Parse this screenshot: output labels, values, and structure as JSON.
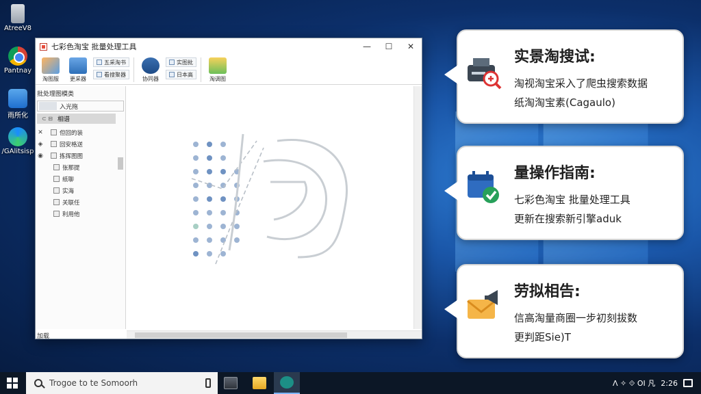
{
  "desktop": {
    "icons": [
      {
        "label": "AtreeV8",
        "icon": "recycle-bin-icon"
      },
      {
        "label": "Pantnay",
        "icon": "chrome-icon"
      },
      {
        "label": "雨所化",
        "icon": "document-icon"
      },
      {
        "label": "/GAlitsisp",
        "icon": "edge-icon"
      }
    ]
  },
  "window": {
    "title": "七彩色淘宝 批量处理工具",
    "controls": {
      "minimize": "—",
      "maximize": "☐",
      "close": "✕"
    },
    "ribbon": {
      "btn1": "淘图服",
      "btn2": "更采器",
      "small1": "五采淘书",
      "small2": "看搜聚器",
      "btn3": "协同器",
      "small3": "实图批",
      "small4": "日本高",
      "btn4": "淘调图"
    },
    "sidebar": {
      "header": "批处理图模类",
      "input_text": "入光拖",
      "selected": "相谱",
      "selected_arrow": "⊂  ⊟",
      "items": [
        {
          "label": "但回的装",
          "glyph": "✕"
        },
        {
          "label": "回安格送",
          "glyph": "◈"
        },
        {
          "label": "拣挥图图",
          "glyph": "◉"
        },
        {
          "label": "张那提",
          "glyph": ""
        },
        {
          "label": "纸聊",
          "glyph": ""
        },
        {
          "label": "实海",
          "glyph": ""
        },
        {
          "label": "关联任",
          "glyph": ""
        },
        {
          "label": "利用他",
          "glyph": ""
        }
      ],
      "status": "加载"
    }
  },
  "cards": [
    {
      "title": "实景淘搜试:",
      "line1": "淘视淘宝采入了爬虫搜索数据",
      "line2": "纸淘淘宝素(Cagaulo)",
      "icon": "printer-search-icon"
    },
    {
      "title": "量操作指南:",
      "line1": "七彩色淘宝 批量处理工具",
      "line2": "更新在搜索新引擎aduk",
      "icon": "calendar-check-icon"
    },
    {
      "title": "劳拟相告:",
      "line1": "信高淘量商圈一步初刻拔数",
      "line2": "更判距Sie)T",
      "icon": "envelope-megaphone-icon"
    }
  ],
  "taskbar": {
    "search_placeholder": "Trogoe to te Somoorh",
    "tray_text": "ᐱ  ✧  ⟐  ΟΙ 凡",
    "tray_time": "2:26"
  }
}
